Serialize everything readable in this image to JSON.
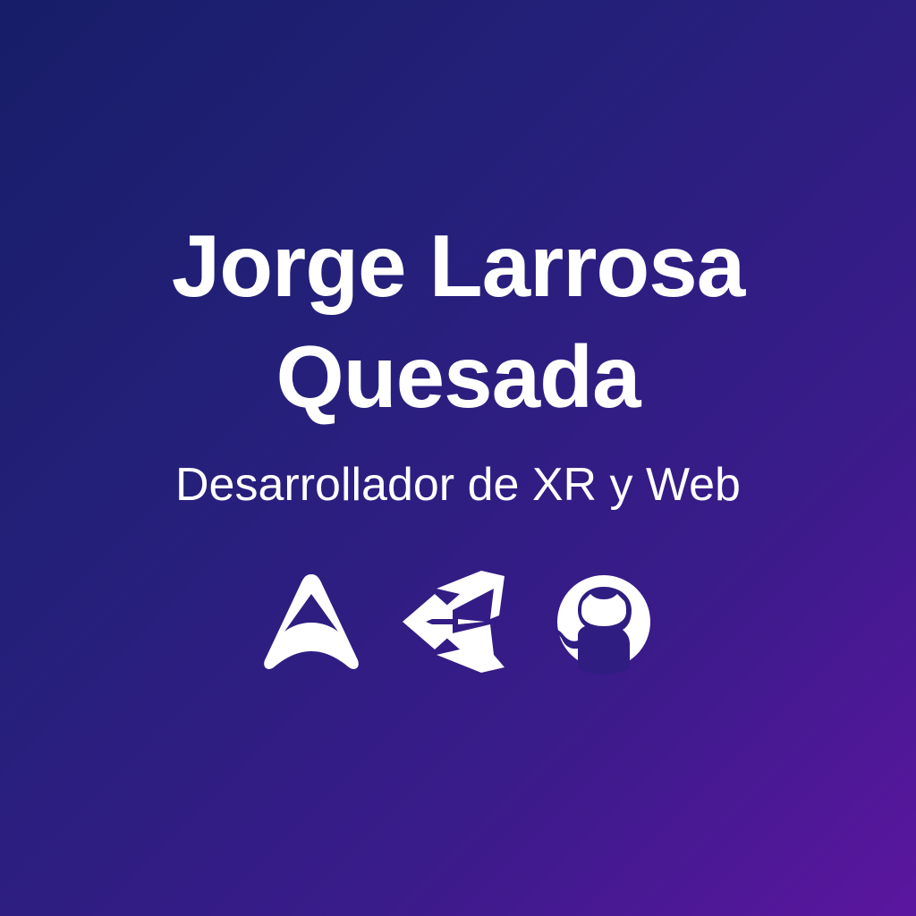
{
  "profile": {
    "name_line_1": "Jorge Larrosa",
    "name_line_2": "Quesada",
    "subtitle": "Desarrollador de XR y Web"
  },
  "icons": [
    {
      "name": "arcore-logo-icon"
    },
    {
      "name": "unity-logo-icon"
    },
    {
      "name": "github-logo-icon"
    }
  ],
  "colors": {
    "gradient_start": "#171d68",
    "gradient_end": "#5b169f",
    "text": "#ffffff"
  }
}
